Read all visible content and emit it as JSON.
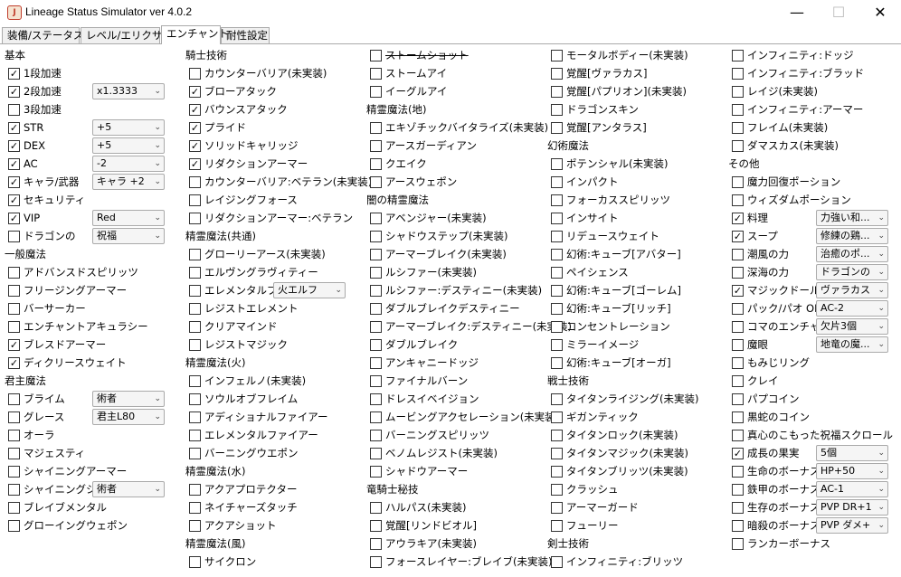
{
  "window": {
    "title": "Lineage Status Simulator ver 4.0.2",
    "icon": "app-java-icon",
    "min": "—",
    "max": "☐",
    "close": "✕"
  },
  "tabs": [
    {
      "label": "装備/ステータス",
      "active": false
    },
    {
      "label": "レベル/エリクサー",
      "active": false
    },
    {
      "label": "エンチャント",
      "active": true
    },
    {
      "label": "耐性設定",
      "active": false
    }
  ],
  "columns": [
    [
      {
        "type": "header",
        "label": "基本"
      },
      {
        "label": "1段加速",
        "checked": true
      },
      {
        "label": "2段加速",
        "checked": true,
        "dropdown": "x1.3333"
      },
      {
        "label": "3段加速",
        "checked": false
      },
      {
        "label": "STR",
        "checked": true,
        "dropdown": "+5"
      },
      {
        "label": "DEX",
        "checked": true,
        "dropdown": "+5"
      },
      {
        "label": "AC",
        "checked": true,
        "dropdown": "-2"
      },
      {
        "label": "キャラ/武器",
        "checked": true,
        "dropdown": "キャラ +2 ..."
      },
      {
        "label": "セキュリティ",
        "checked": true
      },
      {
        "label": "VIP",
        "checked": true,
        "dropdown": "Red"
      },
      {
        "label": "ドラゴンの",
        "checked": false,
        "dropdown": "祝福"
      },
      {
        "type": "header",
        "label": "一般魔法"
      },
      {
        "label": "アドバンスドスピリッツ",
        "checked": false
      },
      {
        "label": "フリージングアーマー",
        "checked": false
      },
      {
        "label": "バーサーカー",
        "checked": false
      },
      {
        "label": "エンチャントアキュラシー",
        "checked": false
      },
      {
        "label": "ブレスドアーマー",
        "checked": true
      },
      {
        "label": "ディクリースウェイト",
        "checked": true
      },
      {
        "type": "header",
        "label": "君主魔法"
      },
      {
        "label": "ブライム",
        "checked": false,
        "dropdown": "術者"
      },
      {
        "label": "グレース",
        "checked": false,
        "dropdown": "君主L80"
      },
      {
        "label": "オーラ",
        "checked": false
      },
      {
        "label": "マジェスティ",
        "checked": false
      },
      {
        "label": "シャイニングアーマー",
        "checked": false
      },
      {
        "label": "シャイニングシ...",
        "checked": false,
        "dropdown": "術者"
      },
      {
        "label": "ブレイブメンタル",
        "checked": false
      },
      {
        "label": "グローイングウェポン",
        "checked": false
      }
    ],
    [
      {
        "type": "header",
        "label": "騎士技術"
      },
      {
        "label": "カウンターバリア(未実装)",
        "checked": false
      },
      {
        "label": "ブローアタック",
        "checked": true
      },
      {
        "label": "バウンスアタック",
        "checked": true
      },
      {
        "label": "プライド",
        "checked": true
      },
      {
        "label": "ソリッドキャリッジ",
        "checked": true
      },
      {
        "label": "リダクションアーマー",
        "checked": true
      },
      {
        "label": "カウンターバリア:ベテラン(未実装)",
        "checked": false
      },
      {
        "label": "レイジングフォース",
        "checked": false
      },
      {
        "label": "リダクションアーマー:ベテラン",
        "checked": false
      },
      {
        "type": "header",
        "label": "精霊魔法(共通)"
      },
      {
        "label": "グローリーアース(未実装)",
        "checked": false
      },
      {
        "label": "エルヴングラヴィティー",
        "checked": false
      },
      {
        "label": "エレメンタルプロ...",
        "checked": false,
        "dropdown": "火エルフ"
      },
      {
        "label": "レジストエレメント",
        "checked": false
      },
      {
        "label": "クリアマインド",
        "checked": false
      },
      {
        "label": "レジストマジック",
        "checked": false
      },
      {
        "type": "header",
        "label": "精霊魔法(火)"
      },
      {
        "label": "インフェルノ(未実装)",
        "checked": false
      },
      {
        "label": "ソウルオブフレイム",
        "checked": false
      },
      {
        "label": "アディショナルファイアー",
        "checked": false
      },
      {
        "label": "エレメンタルファイアー",
        "checked": false
      },
      {
        "label": "バーニングウエポン",
        "checked": false
      },
      {
        "type": "header",
        "label": "精霊魔法(水)"
      },
      {
        "label": "アクアプロテクター",
        "checked": false
      },
      {
        "label": "ネイチャーズタッチ",
        "checked": false
      },
      {
        "label": "アクアショット",
        "checked": false
      },
      {
        "type": "header",
        "label": "精霊魔法(風)"
      },
      {
        "label": "サイクロン",
        "checked": false
      }
    ],
    [
      {
        "label": "ストームショット",
        "checked": false,
        "strike": true
      },
      {
        "label": "ストームアイ",
        "checked": false
      },
      {
        "label": "イーグルアイ",
        "checked": false
      },
      {
        "type": "header",
        "label": "精霊魔法(地)"
      },
      {
        "label": "エキゾチックバイタライズ(未実装)",
        "checked": false
      },
      {
        "label": "アースガーディアン",
        "checked": false
      },
      {
        "label": "クエイク",
        "checked": false
      },
      {
        "label": "アースウェポン",
        "checked": false
      },
      {
        "type": "header",
        "label": "闇の精霊魔法"
      },
      {
        "label": "アベンジャー(未実装)",
        "checked": false
      },
      {
        "label": "シャドウステップ(未実装)",
        "checked": false
      },
      {
        "label": "アーマーブレイク(未実装)",
        "checked": false
      },
      {
        "label": "ルシファー(未実装)",
        "checked": false
      },
      {
        "label": "ルシファー:デスティニー(未実装)",
        "checked": false
      },
      {
        "label": "ダブルブレイクデスティニー",
        "checked": false
      },
      {
        "label": "アーマーブレイク:デスティニー(未実装)",
        "checked": false
      },
      {
        "label": "ダブルブレイク",
        "checked": false
      },
      {
        "label": "アンキャニードッジ",
        "checked": false
      },
      {
        "label": "ファイナルバーン",
        "checked": false
      },
      {
        "label": "ドレスイベイジョン",
        "checked": false
      },
      {
        "label": "ムービングアクセレーション(未実装)",
        "checked": false
      },
      {
        "label": "バーニングスピリッツ",
        "checked": false
      },
      {
        "label": "ベノムレジスト(未実装)",
        "checked": false
      },
      {
        "label": "シャドウアーマー",
        "checked": false
      },
      {
        "type": "header",
        "label": "竜騎士秘技"
      },
      {
        "label": "ハルパス(未実装)",
        "checked": false
      },
      {
        "label": "覚醒[リンドビオル]",
        "checked": false
      },
      {
        "label": "アウラキア(未実装)",
        "checked": false
      },
      {
        "label": "フォースレイヤー:ブレイブ(未実装)",
        "checked": false
      }
    ],
    [
      {
        "label": "モータルボディー(未実装)",
        "checked": false
      },
      {
        "label": "覚醒[ヴァラカス]",
        "checked": false
      },
      {
        "label": "覚醒[パプリオン](未実装)",
        "checked": false
      },
      {
        "label": "ドラゴンスキン",
        "checked": false
      },
      {
        "label": "覚醒[アンタラス]",
        "checked": false
      },
      {
        "type": "header",
        "label": "幻術魔法"
      },
      {
        "label": "ポテンシャル(未実装)",
        "checked": false
      },
      {
        "label": "インパクト",
        "checked": false
      },
      {
        "label": "フォーカススピリッツ",
        "checked": false
      },
      {
        "label": "インサイト",
        "checked": false
      },
      {
        "label": "リデュースウェイト",
        "checked": false
      },
      {
        "label": "幻術:キューブ[アバター]",
        "checked": false
      },
      {
        "label": "ペイシェンス",
        "checked": false
      },
      {
        "label": "幻術:キューブ[ゴーレム]",
        "checked": false
      },
      {
        "label": "幻術:キューブ[リッチ]",
        "checked": false
      },
      {
        "label": "コンセントレーション",
        "checked": false
      },
      {
        "label": "ミラーイメージ",
        "checked": false
      },
      {
        "label": "幻術:キューブ[オーガ]",
        "checked": false
      },
      {
        "type": "header",
        "label": "戦士技術"
      },
      {
        "label": "タイタンライジング(未実装)",
        "checked": false
      },
      {
        "label": "ギガンティック",
        "checked": false
      },
      {
        "label": "タイタンロック(未実装)",
        "checked": false
      },
      {
        "label": "タイタンマジック(未実装)",
        "checked": false
      },
      {
        "label": "タイタンブリッツ(未実装)",
        "checked": false
      },
      {
        "label": "クラッシュ",
        "checked": false
      },
      {
        "label": "アーマーガード",
        "checked": false
      },
      {
        "label": "フューリー",
        "checked": false
      },
      {
        "type": "header",
        "label": "剣士技術"
      },
      {
        "label": "インフィニティ:ブリッツ",
        "checked": false
      }
    ],
    [
      {
        "label": "インフィニティ:ドッジ",
        "checked": false
      },
      {
        "label": "インフィニティ:ブラッド",
        "checked": false
      },
      {
        "label": "レイジ(未実装)",
        "checked": false
      },
      {
        "label": "インフィニティ:アーマー",
        "checked": false
      },
      {
        "label": "フレイム(未実装)",
        "checked": false
      },
      {
        "label": "ダマスカス(未実装)",
        "checked": false
      },
      {
        "type": "header",
        "label": "その他"
      },
      {
        "label": "魔力回復ポーション",
        "checked": false
      },
      {
        "label": "ウィズダムポーション",
        "checked": false
      },
      {
        "label": "料理",
        "checked": true,
        "dropdown": "力強い和..."
      },
      {
        "label": "スープ",
        "checked": true,
        "dropdown": "修練の鶏..."
      },
      {
        "label": "潮風の力",
        "checked": false,
        "dropdown": "治癒のポ..."
      },
      {
        "label": "深海の力",
        "checked": false,
        "dropdown": "ドラゴンの..."
      },
      {
        "label": "マジックドール",
        "checked": true,
        "dropdown": "ヴァラカス"
      },
      {
        "label": "パック/パオ OP",
        "checked": false,
        "dropdown": "AC-2"
      },
      {
        "label": "コマのエンチャ",
        "checked": false,
        "dropdown": "欠片3個"
      },
      {
        "label": "魔眼",
        "checked": false,
        "dropdown": "地竜の魔..."
      },
      {
        "label": "もみじリング",
        "checked": false
      },
      {
        "label": "クレイ",
        "checked": false
      },
      {
        "label": "パプコイン",
        "checked": false
      },
      {
        "label": "黒蛇のコイン",
        "checked": false
      },
      {
        "label": "真心のこもった祝福スクロール",
        "checked": false
      },
      {
        "label": "成長の果実",
        "checked": true,
        "dropdown": "5個"
      },
      {
        "label": "生命のボーナス",
        "checked": false,
        "dropdown": "HP+50"
      },
      {
        "label": "鉄甲のボーナス",
        "checked": false,
        "dropdown": "AC-1"
      },
      {
        "label": "生存のボーナス",
        "checked": false,
        "dropdown": "PVP DR+1"
      },
      {
        "label": "暗殺のボーナス",
        "checked": false,
        "dropdown": "PVP ダメ+1"
      },
      {
        "label": "ランカーボーナス",
        "checked": false
      }
    ]
  ],
  "icons": {
    "checkbox_check": "✓",
    "dropdown_arrow": "⌄"
  }
}
